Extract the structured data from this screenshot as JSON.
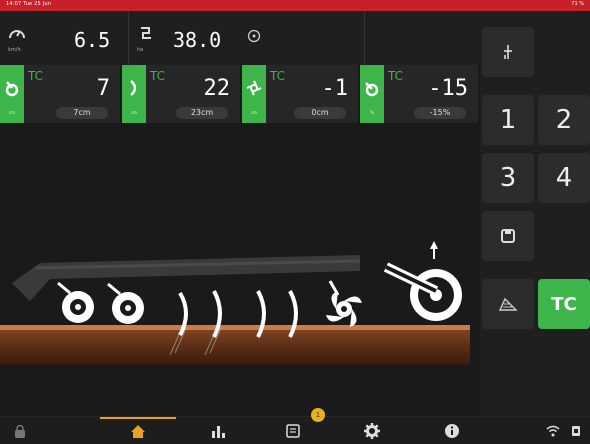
{
  "status": {
    "left": "14:07 Tue 25 Jun",
    "right": "71 %"
  },
  "metrics": {
    "speed": {
      "value": "6.5",
      "unit": "km/h"
    },
    "area": {
      "value": "38.0",
      "unit": "ha"
    }
  },
  "cells": [
    {
      "tc": "TC",
      "value": "7",
      "pill": "7cm",
      "unit": "cm"
    },
    {
      "tc": "TC",
      "value": "22",
      "pill": "23cm",
      "unit": "cm"
    },
    {
      "tc": "TC",
      "value": "-1",
      "pill": "0cm",
      "unit": "cm"
    },
    {
      "tc": "TC",
      "value": "-15",
      "pill": "-15%",
      "unit": "%"
    }
  ],
  "right_panel": {
    "buttons": [
      "1",
      "2",
      "3",
      "4"
    ],
    "tc_label": "TC"
  },
  "nav": {
    "badge": "1"
  },
  "colors": {
    "accent_green": "#3db54a",
    "status_red": "#c8202a",
    "nav_active": "#e7a31b"
  }
}
